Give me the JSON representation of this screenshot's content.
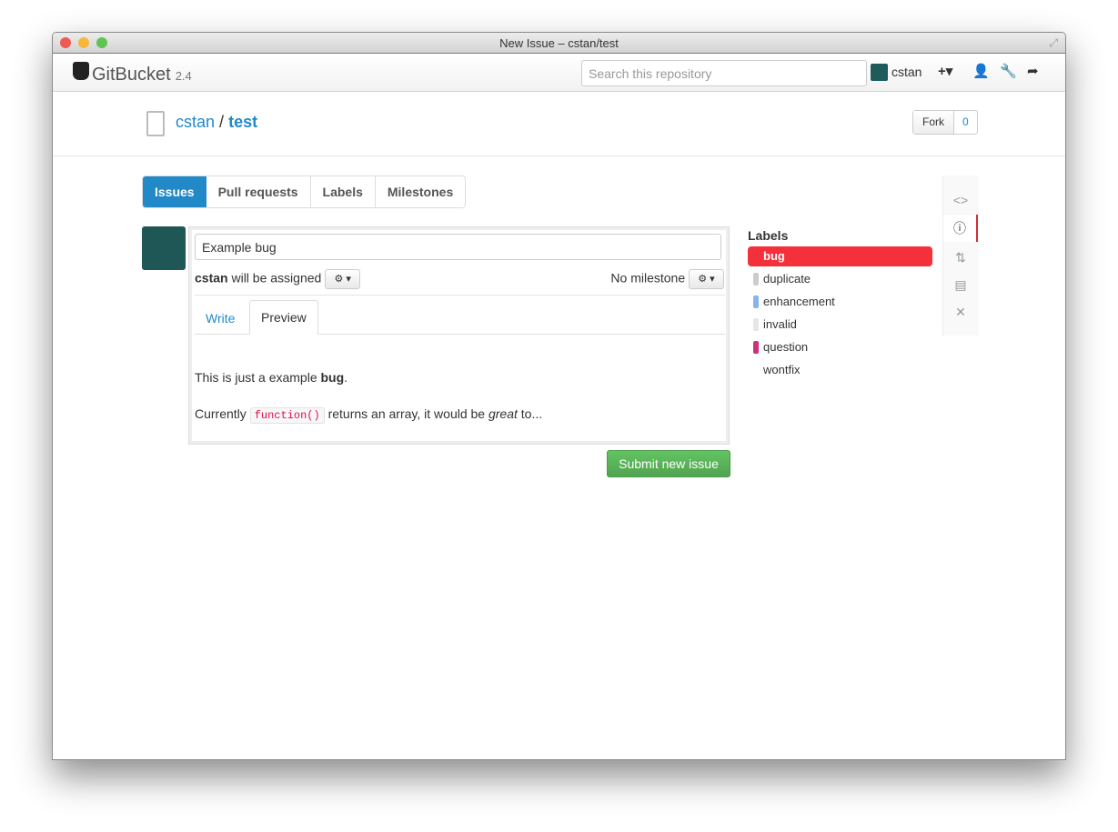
{
  "window": {
    "title": "New Issue – cstan/test"
  },
  "navbar": {
    "brand": "GitBucket",
    "version": "2.4",
    "search_placeholder": "Search this repository",
    "user": "cstan"
  },
  "repo": {
    "owner": "cstan",
    "separator": "/",
    "name": "test",
    "fork_label": "Fork",
    "fork_count": "0"
  },
  "tabs": [
    {
      "label": "Issues",
      "active": true
    },
    {
      "label": "Pull requests"
    },
    {
      "label": "Labels"
    },
    {
      "label": "Milestones"
    }
  ],
  "issue": {
    "title_value": "Example bug",
    "assignee": "cstan",
    "assignee_suffix": " will be assigned",
    "milestone": "No milestone",
    "write_tab": "Write",
    "preview_tab": "Preview",
    "preview": {
      "line1_pre": "This is just a example ",
      "line1_bold": "bug",
      "line1_post": ".",
      "line2_pre": "Currently ",
      "line2_code": "function()",
      "line2_mid": " returns an array, it would be ",
      "line2_em": "great",
      "line2_post": " to..."
    },
    "submit_label": "Submit new issue"
  },
  "labels": {
    "heading": "Labels",
    "items": [
      {
        "name": "bug",
        "color": "#f4303a",
        "selected": true
      },
      {
        "name": "duplicate",
        "color": "#cccccc"
      },
      {
        "name": "enhancement",
        "color": "#84b6eb"
      },
      {
        "name": "invalid",
        "color": "#e6e6e6"
      },
      {
        "name": "question",
        "color": "#cc317c"
      },
      {
        "name": "wontfix",
        "color": "#ffffff"
      }
    ]
  },
  "colors": {
    "accent": "#2189c8",
    "submit": "#5cb85c",
    "active_label": "#f4303a"
  }
}
